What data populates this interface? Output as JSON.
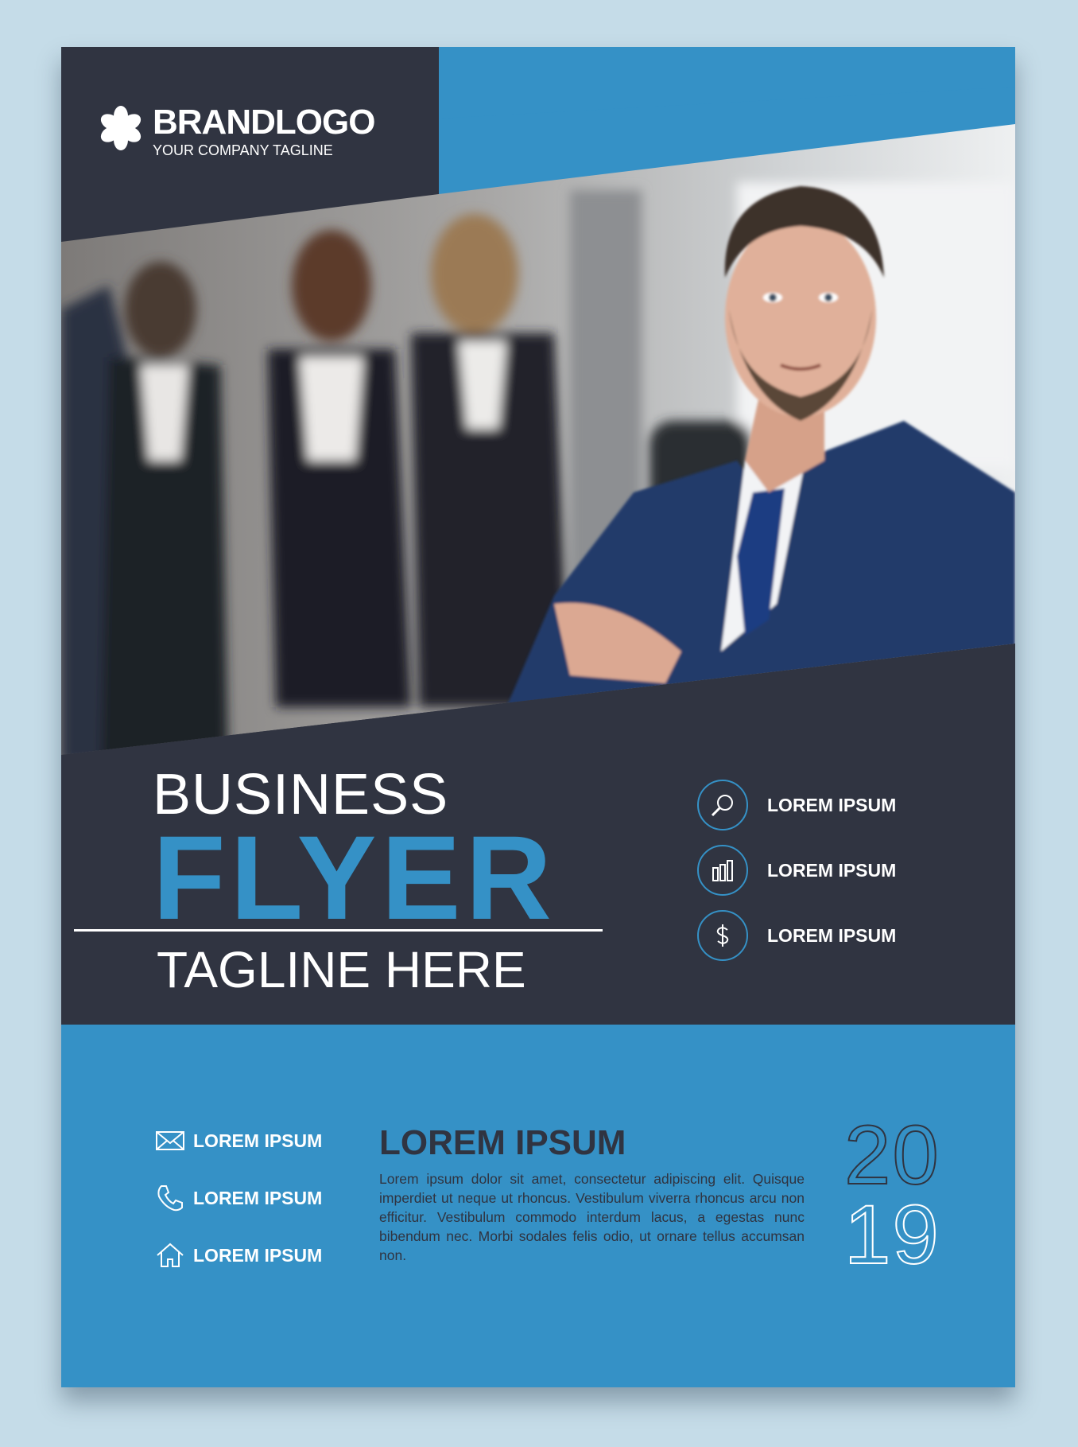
{
  "brand": {
    "name": "BRANDLOGO",
    "tagline": "YOUR COMPANY TAGLINE"
  },
  "title": {
    "line1": "BUSINESS",
    "line2": "FLYER",
    "tagline": "TAGLINE HERE"
  },
  "features": [
    {
      "icon": "magnifier-icon",
      "label": "LOREM IPSUM"
    },
    {
      "icon": "bar-chart-icon",
      "label": "LOREM IPSUM"
    },
    {
      "icon": "dollar-icon",
      "label": "LOREM IPSUM"
    }
  ],
  "contacts": [
    {
      "icon": "mail-icon",
      "label": "LOREM IPSUM"
    },
    {
      "icon": "phone-icon",
      "label": "LOREM IPSUM"
    },
    {
      "icon": "home-icon",
      "label": "LOREM IPSUM"
    }
  ],
  "about": {
    "title": "LOREM IPSUM",
    "body": "Lorem ipsum dolor sit amet, consectetur adipiscing elit. Quisque imperdiet ut neque ut rhoncus. Vestibulum viverra rhoncus arcu non efficitur. Vestibulum commodo interdum lacus, a egestas nunc bibendum nec. Morbi sodales felis odio, ut ornare tellus accumsan non."
  },
  "year": {
    "top": "20",
    "bottom": "19"
  },
  "colors": {
    "navy": "#303441",
    "blue": "#3591c6",
    "background": "#c5dce8"
  }
}
